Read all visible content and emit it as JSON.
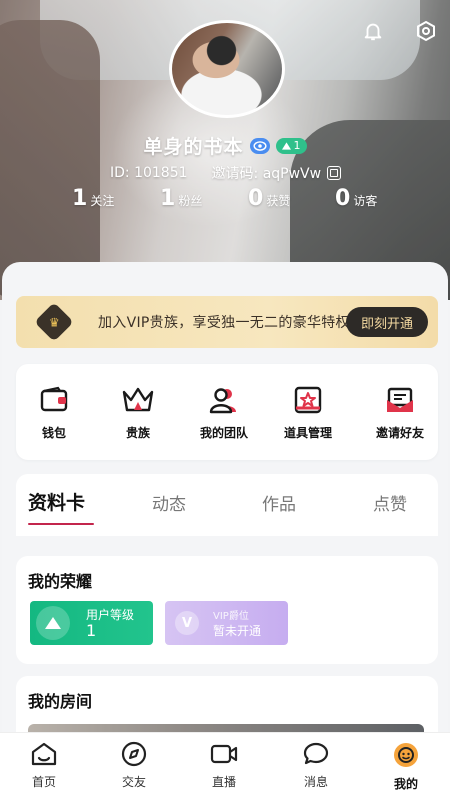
{
  "profile": {
    "nickname": "单身的书本",
    "level_badge": "1",
    "id_text": "ID: 101851",
    "invite_text": "邀请码: aqPwVw"
  },
  "stats": [
    {
      "num": "1",
      "label": "关注"
    },
    {
      "num": "1",
      "label": "粉丝"
    },
    {
      "num": "0",
      "label": "获赞"
    },
    {
      "num": "0",
      "label": "访客"
    }
  ],
  "vip_banner": {
    "text": "加入VIP贵族，享受独一无二的豪华特权",
    "button": "即刻开通"
  },
  "tools": [
    {
      "label": "钱包",
      "icon": "wallet-icon"
    },
    {
      "label": "贵族",
      "icon": "crown-icon"
    },
    {
      "label": "我的团队",
      "icon": "team-icon"
    },
    {
      "label": "道具管理",
      "icon": "props-icon"
    },
    {
      "label": "邀请好友",
      "icon": "invite-icon"
    }
  ],
  "tabs": [
    "资料卡",
    "动态",
    "作品",
    "点赞"
  ],
  "honor": {
    "title": "我的荣耀",
    "user_level_label": "用户等级",
    "user_level_value": "1",
    "vip_label": "VIP爵位",
    "vip_value": "暂未开通"
  },
  "room": {
    "title": "我的房间"
  },
  "nav": [
    {
      "label": "首页",
      "icon": "home-icon"
    },
    {
      "label": "交友",
      "icon": "compass-icon"
    },
    {
      "label": "直播",
      "icon": "video-icon"
    },
    {
      "label": "消息",
      "icon": "chat-icon"
    },
    {
      "label": "我的",
      "icon": "me-icon"
    }
  ],
  "colors": {
    "accent_red": "#c3254c",
    "level_green": "#22c48d",
    "vip_gold": "#f3dfae",
    "vip_purple": "#c6adf0",
    "me_orange": "#f5a33b"
  }
}
